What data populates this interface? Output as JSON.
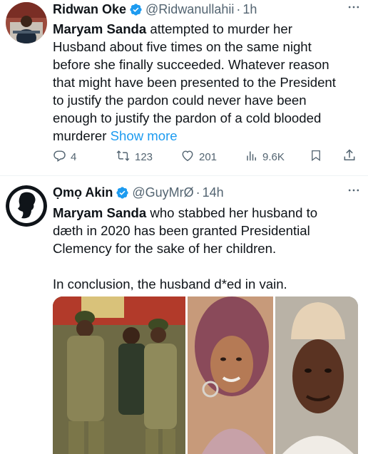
{
  "tweets": [
    {
      "name": "Ridwan Oke",
      "handle": "@Ridwanullahii",
      "time": "1h",
      "text_bold": "Maryam Sanda",
      "text_lines": [
        " attempted to murder her",
        "Husband about five times on the same night",
        "before she finally succeeded. Whatever reason",
        "that might have been presented to the President",
        "to justify the pardon could never have been",
        "enough to justify the pardon of a cold blooded",
        "murderer"
      ],
      "show_more": "Show more",
      "replies": "4",
      "reposts": "123",
      "likes": "201",
      "views": "9.6K"
    },
    {
      "name": "Ọmọ Akin",
      "handle": "@GuyMrØ",
      "time": "14h",
      "text_bold": "Maryam Sanda",
      "text_lines": [
        " who stabbed her husband to",
        "dæth in 2020 has been granted Presidential",
        "Clemency for the sake of her children."
      ],
      "text_para2": "In conclusion, the husband d*ed in vain."
    }
  ],
  "icons": {
    "more": "more-horizontal-icon",
    "verified": "verified-badge-icon",
    "reply": "reply-icon",
    "repost": "repost-icon",
    "like": "heart-icon",
    "views": "views-chart-icon",
    "bookmark": "bookmark-icon",
    "share": "share-icon"
  },
  "colors": {
    "accent": "#1d9bf0",
    "text": "#0f1419",
    "muted": "#536471",
    "divider": "#eff3f4"
  }
}
